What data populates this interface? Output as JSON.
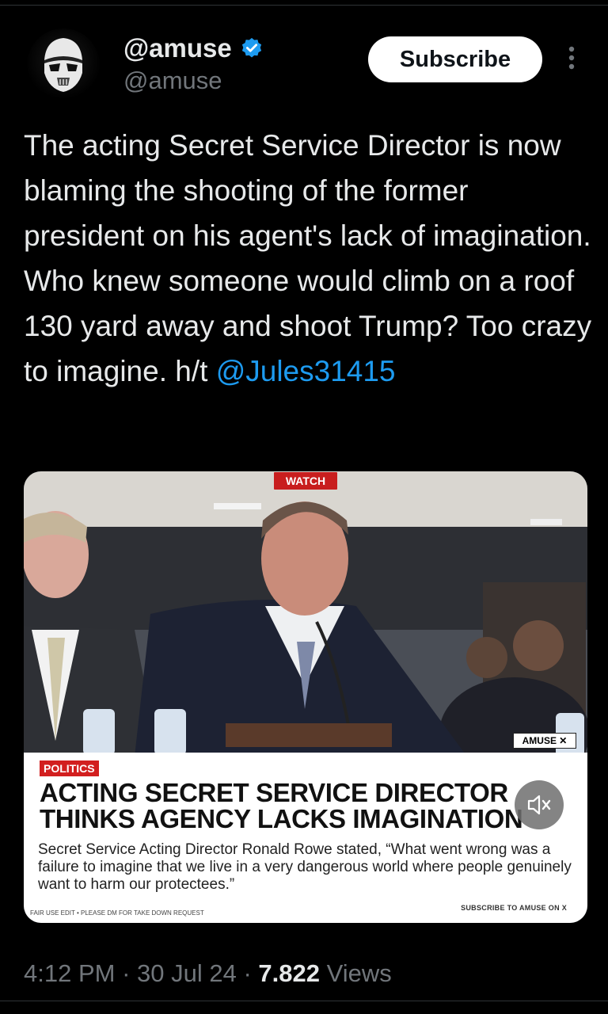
{
  "author": {
    "display_name": "@amuse",
    "handle": "@amuse",
    "verified": true
  },
  "subscribe_label": "Subscribe",
  "tweet": {
    "text": "The acting Secret Service Director is now blaming the shooting of the former president on his agent's lack of imagination. Who knew someone would climb on a roof 130 yard away and shoot Trump? Too crazy to imagine. h/t ",
    "mention": "@Jules31415"
  },
  "media": {
    "watch_label": "WATCH",
    "badge": "AMUSE",
    "category": "POLITICS",
    "headline_line1": "ACTING SECRET SERVICE DIRECTOR",
    "headline_line2": "THINKS AGENCY LACKS IMAGINATION",
    "body": "Secret Service Acting Director Ronald Rowe stated, “What went wrong was a failure to imagine that we live in a very dangerous world where people genuinely want to harm our protectees.”",
    "fair_use": "FAIR USE EDIT • PLEASE DM FOR TAKE DOWN REQUEST",
    "subscribe_x": "SUBSCRIBE TO AMUSE ON X"
  },
  "meta": {
    "time": "4:12 PM",
    "date": "30 Jul 24",
    "views_count": "7.822",
    "views_label": "Views"
  },
  "colors": {
    "background": "#000000",
    "text": "#e7e9ea",
    "muted": "#71767b",
    "link": "#1d9bf0",
    "verified": "#1d9bf0",
    "accent_red": "#d21f1f"
  }
}
